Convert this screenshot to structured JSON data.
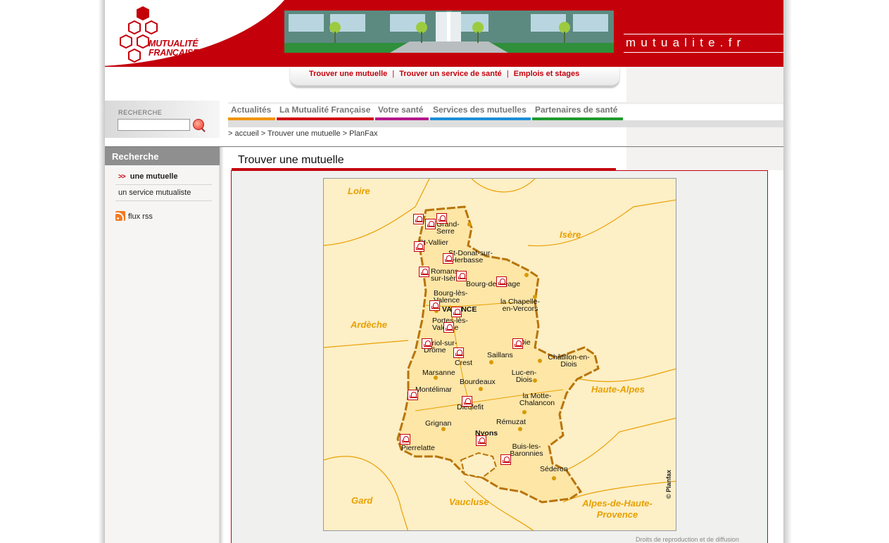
{
  "header": {
    "logo_text_line1": "MUTUALITÉ",
    "logo_text_line2": "FRANÇAISE",
    "site_domain": "mutualite.fr",
    "top_links": [
      "Trouver une mutuelle",
      "Trouver un service de santé",
      "Emplois et stages"
    ],
    "top_link_separator": "|"
  },
  "search": {
    "label": "RECHERCHE",
    "input_value": "",
    "button_icon": "search-icon"
  },
  "nav": {
    "tabs": [
      {
        "label": "Actualités",
        "color": "#f29400"
      },
      {
        "label": "La Mutualité Française",
        "color": "#d20a11"
      },
      {
        "label": "Votre santé",
        "color": "#b4168a"
      },
      {
        "label": "Services des mutuelles",
        "color": "#1b8fd8"
      },
      {
        "label": "Partenaires de santé",
        "color": "#1f9a2f"
      }
    ]
  },
  "breadcrumb": "> accueil > Trouver une mutuelle > PlanFax",
  "sidebar": {
    "heading": "Recherche",
    "items": [
      {
        "label": "une mutuelle",
        "active": true,
        "marker": ">>"
      },
      {
        "label": "un service mutualiste",
        "active": false
      }
    ],
    "rss_label": "flux rss",
    "rss_icon": "rss-icon"
  },
  "main": {
    "title": "Trouver une mutuelle",
    "map": {
      "regions": [
        "Loire",
        "Isère",
        "Ardèche",
        "Haute-Alpes",
        "Gard",
        "Vaucluse",
        "Alpes-de-Haute-Provence"
      ],
      "towns": [
        "Grand-Serre",
        "St-Vallier",
        "St-Donat-sur-l'Herbasse",
        "Romans-sur-Isère",
        "Bourg-de-Péage",
        "Bourg-lès-Valence",
        "la Chapelle-en-Vercors",
        "VALENCE",
        "Portes-lès-Valence",
        "Die",
        "Loriol-sur-Drôme",
        "Crest",
        "Saillans",
        "Châtillon-en-Diois",
        "Marsanne",
        "Luc-en-Diois",
        "Bourdeaux",
        "Montélimar",
        "la Motte-Chalancon",
        "Dieulefit",
        "Grignan",
        "Rémuzat",
        "Nyons",
        "Pierrelatte",
        "Buis-les-Baronnies",
        "Séderon"
      ],
      "marker_icon": "mutuelle-marker-icon",
      "copyright": "© Planfax"
    },
    "rights_text": "Droits de reproduction et de diffusion"
  },
  "colors": {
    "brand_red": "#c4000b",
    "map_fill": "#fdefc6",
    "map_accent": "#e8a000",
    "sidebar_head": "#8f8f8f"
  }
}
